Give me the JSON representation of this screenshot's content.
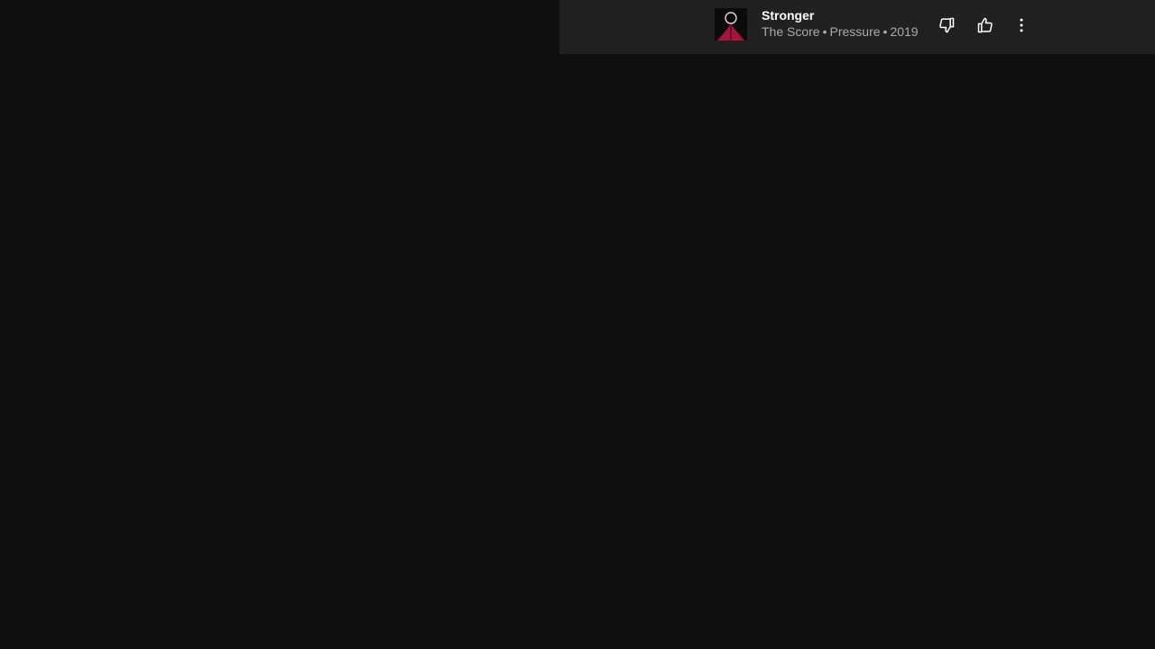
{
  "player": {
    "track_title": "Stronger",
    "artist": "The Score",
    "album": "Pressure",
    "year": "2019",
    "separator": "•",
    "thumbnail_icon": "album-art",
    "actions": {
      "dislike_icon": "thumbs-down-icon",
      "like_icon": "thumbs-up-icon",
      "more_icon": "more-vert-icon"
    }
  },
  "colors": {
    "background": "#101010",
    "player_bar": "#212121",
    "title": "#ffffff",
    "subtitle": "#aaaaaa",
    "album_art_accent": "#a3163a"
  }
}
